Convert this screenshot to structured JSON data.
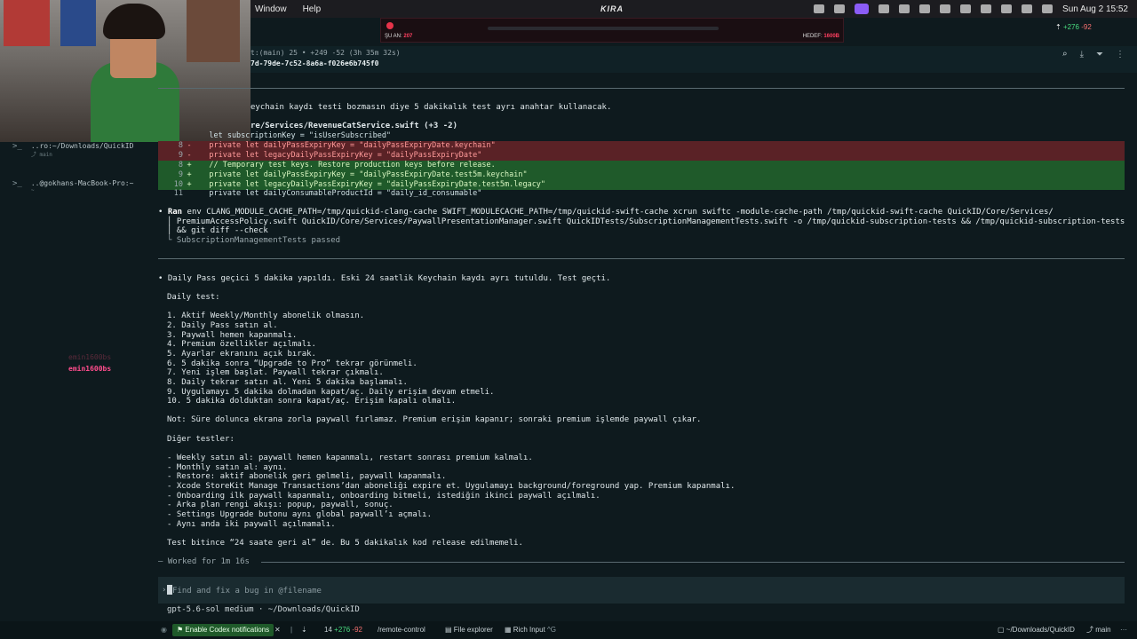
{
  "menubar": {
    "items": [
      "Window",
      "Help"
    ],
    "center": "KIRA",
    "clock": "Sun Aug 2  15:52"
  },
  "overlay": {
    "left_label": "ŞU AN:",
    "left_value": "207",
    "right_label": "HEDEF:",
    "right_value": "1600B"
  },
  "session_header": {
    "line1": "t:(main) 25 • +249 -52 (3h 35m 32s)",
    "line2": "7d-79de-7c52-8a6a-f026e6b745f0",
    "diffstat": {
      "add": "+276",
      "del": "-92"
    }
  },
  "sidebar": {
    "sessions": [
      {
        "label": "..ro:~/Downloads/QuickID",
        "sub": "main"
      },
      {
        "label": "..@gokhans-MacBook-Pro:~",
        "sub": "~"
      }
    ],
    "viewer_faded": "emin1600bs",
    "viewer_active": "emin1600bs"
  },
  "content": {
    "intro": "eychain kaydı testi bozmasın diye 5 dakikalık test ayrı anahtar kullanacak.",
    "file_line": "re/Services/RevenueCatService.swift (+3 -2)",
    "diff": [
      {
        "type": "ctx",
        "num": "",
        "sign": "",
        "code": "   let subscriptionKey = \"isUserSubscribed\""
      },
      {
        "type": "del",
        "num": "8",
        "sign": "-",
        "code": "   private let dailyPassExpiryKey = \"dailyPassExpiryDate.keychain\""
      },
      {
        "type": "del",
        "num": "9",
        "sign": "-",
        "code": "   private let legacyDailyPassExpiryKey = \"dailyPassExpiryDate\""
      },
      {
        "type": "add",
        "num": "8",
        "sign": "+",
        "code": "   // Temporary test keys. Restore production keys before release."
      },
      {
        "type": "add",
        "num": "9",
        "sign": "+",
        "code": "   private let dailyPassExpiryKey = \"dailyPassExpiryDate.test5m.keychain\""
      },
      {
        "type": "add",
        "num": "10",
        "sign": "+",
        "code": "   private let legacyDailyPassExpiryKey = \"dailyPassExpiryDate.test5m.legacy\""
      },
      {
        "type": "ctx",
        "num": "11",
        "sign": "",
        "code": "   private let dailyConsumableProductId = \"daily_id_consumable\""
      }
    ],
    "ran_word": "Ran",
    "ran_line1": " env CLANG_MODULE_CACHE_PATH=/tmp/quickid-clang-cache SWIFT_MODULECACHE_PATH=/tmp/quickid-swift-cache xcrun swiftc -module-cache-path /tmp/quickid-swift-cache QuickID/Core/Services/",
    "ran_line2": "PremiumAccessPolicy.swift QuickID/Core/Services/PaywallPresentationManager.swift QuickIDTests/SubscriptionManagementTests.swift -o /tmp/quickid-subscription-tests && /tmp/quickid-subscription-tests",
    "ran_line3": "&& git diff --check",
    "ran_result": "SubscriptionManagementTests passed",
    "summary": "• Daily Pass geçici 5 dakika yapıldı. Eski 24 saatlik Keychain kaydı ayrı tutuldu. Test geçti.",
    "daily_title": "Daily test:",
    "daily_steps": [
      "1. Aktif Weekly/Monthly abonelik olmasın.",
      "2. Daily Pass satın al.",
      "3. Paywall hemen kapanmalı.",
      "4. Premium özellikler açılmalı.",
      "5. Ayarlar ekranını açık bırak.",
      "6. 5 dakika sonra “Upgrade to Pro” tekrar görünmeli.",
      "7. Yeni işlem başlat. Paywall tekrar çıkmalı.",
      "8. Daily tekrar satın al. Yeni 5 dakika başlamalı.",
      "9. Uygulamayı 5 dakika dolmadan kapat/aç. Daily erişim devam etmeli.",
      "10. 5 dakika dolduktan sonra kapat/aç. Erişim kapalı olmalı."
    ],
    "note": "Not: Süre dolunca ekrana zorla paywall fırlamaz. Premium erişim kapanır; sonraki premium işlemde paywall çıkar.",
    "other_title": "Diğer testler:",
    "other_items": [
      "- Weekly satın al: paywall hemen kapanmalı, restart sonrası premium kalmalı.",
      "- Monthly satın al: aynı.",
      "- Restore: aktif abonelik geri gelmeli, paywall kapanmalı.",
      "- Xcode StoreKit Manage Transactions’dan aboneliği expire et. Uygulamayı background/foreground yap. Premium kapanmalı.",
      "- Onboarding ilk paywall kapanmalı, onboarding bitmeli, istediğin ikinci paywall açılmalı.",
      "- Arka plan rengi akışı: popup, paywall, sonuç.",
      "- Settings Upgrade butonu aynı global paywall’ı açmalı.",
      "- Aynı anda iki paywall açılmamalı."
    ],
    "final": "Test bitince “24 saate geri al” de. Bu 5 dakikalık kod release edilmemeli.",
    "worked": "— Worked for 1m 16s"
  },
  "prompt": {
    "placeholder": "Find and fix a bug in @filename",
    "model": "gpt-5.6-sol medium · ~/Downloads/QuickID"
  },
  "statusbar": {
    "notif": "Enable Codex notifications",
    "diff_count": "14",
    "diff_add": "+276",
    "diff_del": "-92",
    "remote": "/remote-control",
    "explorer": "File explorer",
    "rich": "Rich Input",
    "rich_key": "^G",
    "path": "~/Downloads/QuickID",
    "branch": "main"
  }
}
